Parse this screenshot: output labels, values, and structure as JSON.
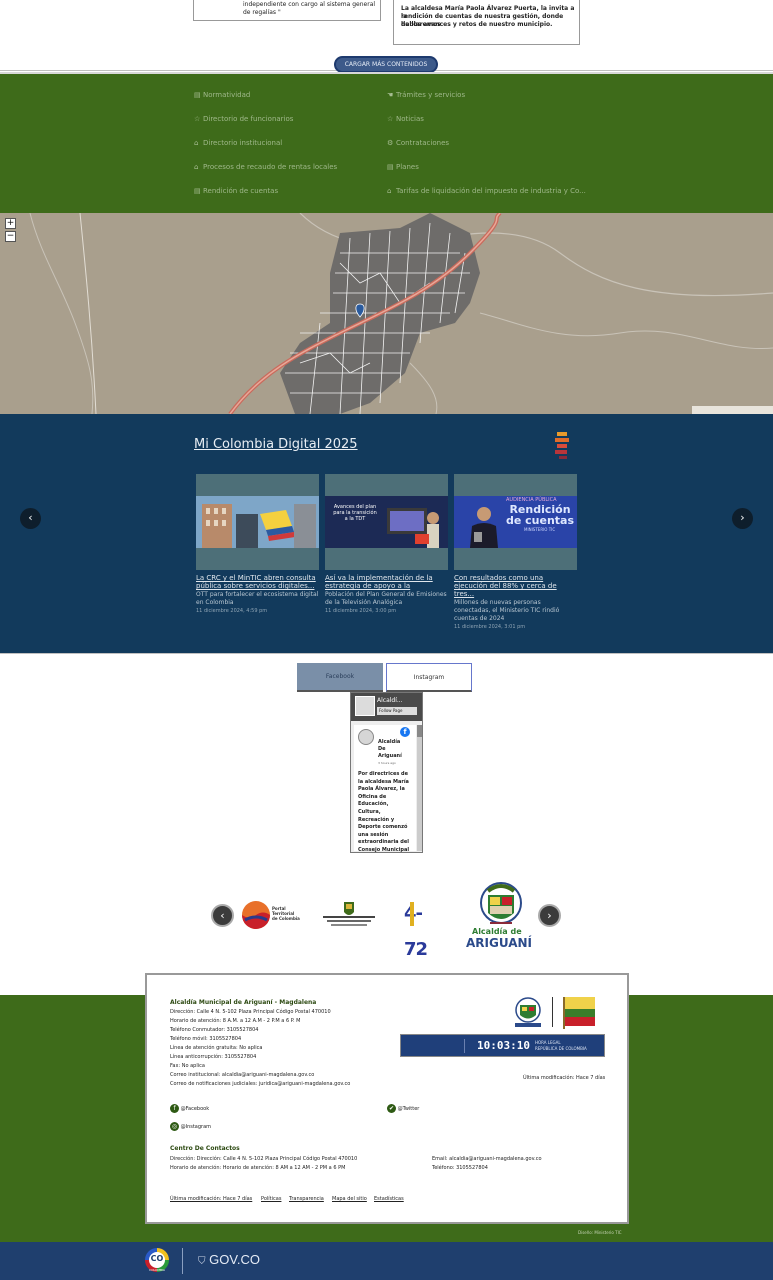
{
  "top_cards": {
    "left_text": [
      "independiente con cargo al sistema general",
      "de regalías \""
    ],
    "right_text": [
      "La alcaldesa María Paola Álvarez Puerta, la invita a la",
      "rendición de cuentas de nuestra gestión, donde hablaremos",
      "de los avances y retos de nuestro municipio."
    ]
  },
  "load_more_label": "CARGAR MÁS CONTENIDOS",
  "quick_links": {
    "left": [
      "Normatividad",
      "Directorio de funcionarios",
      "Directorio institucional",
      "Procesos de recaudo de rentas locales",
      "Rendición de cuentas"
    ],
    "right": [
      "Trámites y servicios",
      "Noticias",
      "Contrataciones",
      "Planes",
      "Tarifas de liquidación del impuesto de industria y Co..."
    ]
  },
  "map": {
    "zoom_in": "+",
    "zoom_out": "−"
  },
  "mi_colombia": {
    "title": "Mi Colombia Digital 2025",
    "prev": "‹",
    "next": "›",
    "news": [
      {
        "title": "La CRC y el MinTIC abren consulta pública sobre servicios digitales...",
        "desc": "OTT para fortalecer el ecosistema digital en Colombia",
        "date": "11 diciembre 2024, 4:59 pm"
      },
      {
        "title": "Así va la implementación de la estrategia de apoyo a la",
        "desc": "Población del Plan General de Emisiones de la Televisión Analógica",
        "date": "11 diciembre 2024, 3:00 pm",
        "img_text": "Avances del plan para la transición a la TDT"
      },
      {
        "title": "Con resultados como una ejecución del 88% y cerca de tres...",
        "desc": "Millones de nuevas personas conectadas, el Ministerio TIC rindió cuentas de 2024",
        "date": "11 diciembre 2024, 3:01 pm",
        "img_text_small": "AUDIENCIA PÚBLICA",
        "img_text_big": "Rendición de cuentas",
        "img_text_footer": "MINISTERIO TIC"
      }
    ]
  },
  "social": {
    "tab_facebook": "Facebook",
    "tab_instagram": "Instagram",
    "fb_header": "Alcaldí...",
    "fb_follow": "Follow Page",
    "fb_post_author": [
      "Alcaldía",
      "De",
      "Ariguaní"
    ],
    "fb_post_time": "3 hours ago",
    "fb_post_text": [
      "Por directrices de",
      "la alcaldesa María",
      "Paola Álvarez, la",
      "Oficina de",
      "Educación,",
      "Cultura,",
      "Recreación y",
      "Deporte comenzó",
      "una sesión",
      "extraordinaria del",
      "Consejo Municipal"
    ]
  },
  "logos": {
    "prev": "‹",
    "next": "›",
    "portal_label": [
      "Portal",
      "Territorial",
      "de Colombia"
    ],
    "postal_label": "4-72",
    "alcaldia_label_top": "Alcaldía de",
    "alcaldia_label_big": "ARIGUANÍ"
  },
  "footer": {
    "org_name": "Alcaldía Municipal de Ariguaní - Magdalena",
    "lines": [
      "Dirección: Calle 4 N. 5-102 Plaza Principal Código Postal 470010",
      "Horario de atención: 8 A.M. a 12 A.M - 2 P.M a 6 P. M",
      "Teléfono Conmutador: 3105527804",
      "Teléfono móvil: 3105527804",
      "Línea de atención gratuita: No aplica",
      "Línea anticorrupción: 3105527804",
      "Fax: No aplica",
      "Correo institucional: alcaldia@ariguani-magdalena.gov.co",
      "Correo de notificaciones judiciales: juridica@ariguani-magdalena.gov.co"
    ],
    "social_facebook": "@Facebook",
    "social_twitter": "@Twitter",
    "social_instagram": "@Instagram",
    "contact_title": "Centro De Contactos",
    "contact_address": "Dirección: Dirección: Calle 4 N. 5-102 Plaza Principal Código Postal 470010",
    "contact_hours": "Horario de atención: Horario de atención: 8 AM a 12 AM - 2 PM a 6 PM",
    "contact_email": "Email: alcaldia@ariguani-magdalena.gov.co",
    "contact_phone": "Teléfono: 3105527804",
    "clock_time": "10:03:10",
    "clock_label_1": "HORA LEGAL",
    "clock_label_2": "REPÚBLICA DE COLOMBIA",
    "last_update_right": "Última modificación: Hace 7 días",
    "bottom_links": [
      "Última modificación: Hace 7 días",
      "Políticas",
      "Transparencia",
      "Mapa del sitio",
      "Estadísticas"
    ],
    "credit": "Diseño: Ministerio TIC",
    "gov_label": "GOV.CO",
    "co_label": "CO",
    "co_sublabel": "COLOMBIA"
  },
  "colors": {
    "green": "#3e6b1a",
    "navy": "#123a5c",
    "gov_blue": "#1f3f6e"
  }
}
